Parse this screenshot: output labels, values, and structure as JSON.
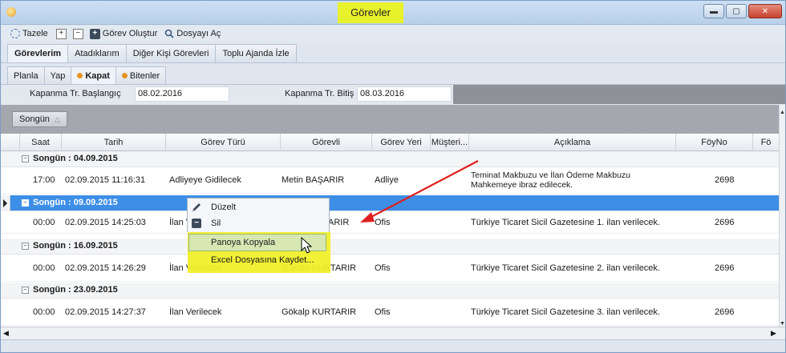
{
  "window": {
    "title": "Görevler",
    "buttons": [
      "minimize",
      "maximize",
      "close"
    ]
  },
  "toolbar": {
    "refresh_label": "Tazele",
    "expand_icon": "plus-box-icon",
    "collapse_icon": "minus-box-icon",
    "create_label": "Görev Oluştur",
    "search_file_label": "Dosyayı Aç"
  },
  "main_tabs": [
    {
      "label": "Görevlerim",
      "active": true
    },
    {
      "label": "Atadıklarım",
      "active": false
    },
    {
      "label": "Diğer Kişi Görevleri",
      "active": false
    },
    {
      "label": "Toplu Ajanda İzle",
      "active": false
    }
  ],
  "sub_tabs": [
    {
      "label": "Planla",
      "dot": false,
      "active": false
    },
    {
      "label": "Yap",
      "dot": false,
      "active": false
    },
    {
      "label": "Kapat",
      "dot": true,
      "active": true
    },
    {
      "label": "Bitenler",
      "dot": true,
      "active": false
    }
  ],
  "filter": {
    "start_label": "Kapanma Tr. Başlangıç",
    "start_value": "08.02.2016",
    "end_label": "Kapanma Tr. Bitiş",
    "end_value": "08.03.2016"
  },
  "group_chip": {
    "label": "Songün",
    "arrow": "△"
  },
  "columns": [
    "Saat",
    "Tarih",
    "Görev Türü",
    "Görevli",
    "Görev Yeri",
    "Müşteri...",
    "Açıklama",
    "FöyNo",
    "Fö"
  ],
  "groups": [
    {
      "label": "Songün : 04.09.2015",
      "selected": false,
      "row": {
        "saat": "17:00",
        "tarih": "02.09.2015 11:16:31",
        "tur": "Adliyeye Gidilecek",
        "gorevli": "Metin BAŞARIR",
        "yer": "Adliye",
        "aciklama": "Teminat Makbuzu ve İlan Ödeme Makbuzu Mahkemeye ibraz edilecek.",
        "foy": "2698"
      }
    },
    {
      "label": "Songün : 09.09.2015",
      "selected": true,
      "row": {
        "saat": "00:00",
        "tarih": "02.09.2015 14:25:03",
        "tur": "İlan V",
        "gorevli": "ARIR",
        "yer": "Ofis",
        "aciklama": "Türkiye Ticaret Sicil Gazetesine 1. ilan verilecek.",
        "foy": "2696"
      }
    },
    {
      "label": "Songün : 16.09.2015",
      "selected": false,
      "row": {
        "saat": "00:00",
        "tarih": "02.09.2015 14:26:29",
        "tur": "İlan Verilecek",
        "gorevli": "Gökalp KURTARIR",
        "yer": "Ofis",
        "aciklama": "Türkiye Ticaret Sicil Gazetesine 2. ilan verilecek.",
        "foy": "2696"
      }
    },
    {
      "label": "Songün : 23.09.2015",
      "selected": false,
      "row": {
        "saat": "00:00",
        "tarih": "02.09.2015 14:27:37",
        "tur": "İlan Verilecek",
        "gorevli": "Gökalp KURTARIR",
        "yer": "Ofis",
        "aciklama": "Türkiye Ticaret Sicil Gazetesine 3. ilan verilecek.",
        "foy": "2696"
      }
    }
  ],
  "context_menu": {
    "items": [
      "Düzelt",
      "Sil",
      "Panoya Kopyala",
      "Excel Dosyasına Kaydet..."
    ],
    "highlight_color": "#f0ef2a",
    "selected_item": "Panoya Kopyala"
  },
  "colors": {
    "title_highlight": "#e8f22c",
    "selection": "#3d8ee6",
    "arrow": "#e02020"
  }
}
